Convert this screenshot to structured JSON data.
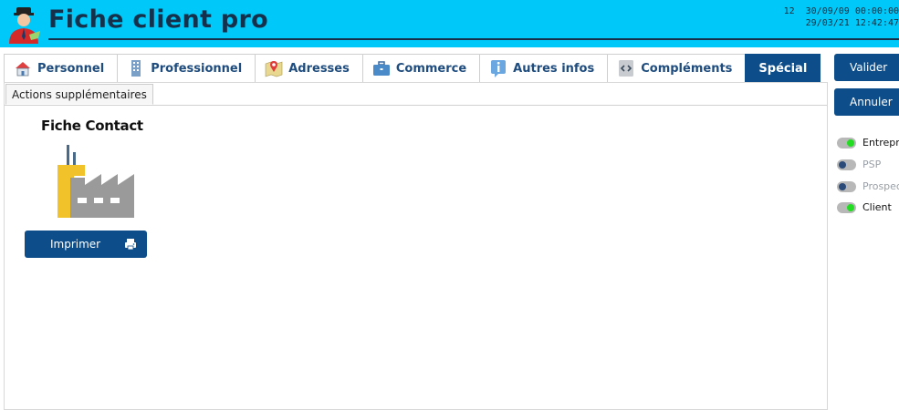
{
  "header": {
    "title": "Fiche client pro",
    "meta_line1": "12  30/09/09 00:00:00",
    "meta_line2": "29/03/21 12:42:47",
    "bg_color": "#00c8f8"
  },
  "tabs": [
    {
      "label": "Personnel",
      "icon": "house-icon"
    },
    {
      "label": "Professionnel",
      "icon": "building-icon"
    },
    {
      "label": "Adresses",
      "icon": "map-pin-icon"
    },
    {
      "label": "Commerce",
      "icon": "briefcase-icon"
    },
    {
      "label": "Autres infos",
      "icon": "info-icon"
    },
    {
      "label": "Compléments",
      "icon": "code-icon"
    },
    {
      "label": "Spécial",
      "active": true
    }
  ],
  "subtab": {
    "label": "Actions supplémentaires"
  },
  "card": {
    "title": "Fiche Contact",
    "icon": "factory-icon",
    "print_label": "Imprimer",
    "print_icon": "printer-icon"
  },
  "actions": {
    "validate_label": "Valider",
    "cancel_label": "Annuler"
  },
  "toggles": [
    {
      "label": "Entrepri",
      "on": true
    },
    {
      "label": "PSP",
      "on": false
    },
    {
      "label": "Prospect",
      "on": false
    },
    {
      "label": "Client",
      "on": true
    }
  ],
  "colors": {
    "accent": "#0d4e8a",
    "toggle_on": "#22dd22",
    "toggle_off": "#2a4a7a"
  }
}
